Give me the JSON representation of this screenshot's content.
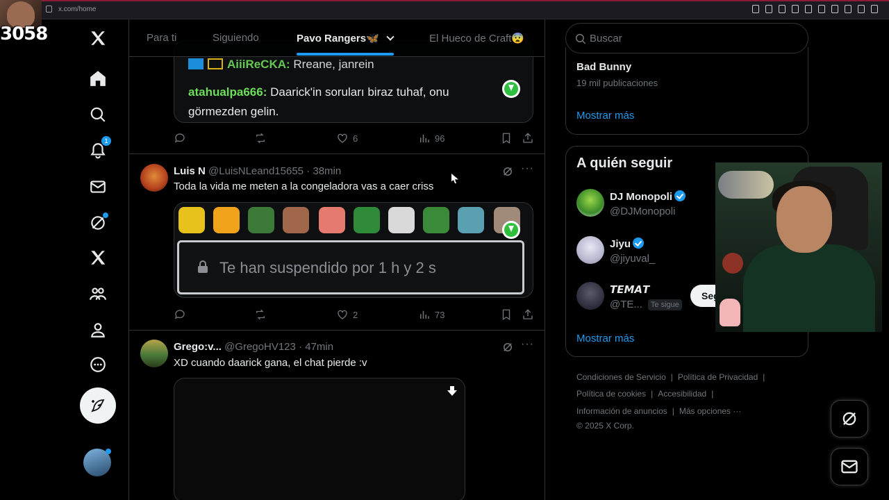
{
  "browser": {
    "url": "x.com/home"
  },
  "overlay": {
    "counter": "3058"
  },
  "nav": {
    "notifications_badge": "1"
  },
  "tabs": [
    {
      "label": "Para ti"
    },
    {
      "label": "Siguiendo"
    },
    {
      "label": "Pavo Rangers🦋"
    },
    {
      "label": "El Hueco de Craft😨"
    }
  ],
  "tweets": [
    {
      "chat_lines": [
        {
          "user": "AiiiReCKA:",
          "text": " Rreane, janrein"
        },
        {
          "user": "atahualpa666:",
          "text": " Daarick'in soruları biraz tuhaf, onu"
        },
        {
          "user": "",
          "text": "görmezden gelin."
        }
      ],
      "likes": "6",
      "views": "96"
    },
    {
      "name": "Luis N",
      "handle": "@LuisNLeand15655",
      "time": "· 38min",
      "text": "Toda la vida me meten a la congeladora vas a caer criss",
      "suspended_text": "Te han suspendido por 1 h y 2 s",
      "likes": "2",
      "views": "73"
    },
    {
      "name": "Grego:v...",
      "handle": "@GregoHV123",
      "time": "· 47min",
      "text": "XD cuando daarick gana, el chat pierde :v"
    }
  ],
  "sidebar": {
    "search_placeholder": "Buscar",
    "trend_name": "Bad Bunny",
    "trend_count": "19 mil publicaciones",
    "show_more_1": "Mostrar más",
    "who_to_follow_title": "A quién seguir",
    "suggestions": [
      {
        "name": "DJ Monopoli",
        "handle": "@DJMonopoli"
      },
      {
        "name": "Jiyu",
        "handle": "@jiyuval_"
      },
      {
        "name": "𝙏𝙀𝙈𝘼𝙏",
        "handle": "@TE...",
        "follows_you": "Te sigue"
      }
    ],
    "follow_label": "Seguir",
    "show_more_2": "Mostrar más",
    "footer": {
      "terms": "Condiciones de Servicio",
      "privacy": "Política de Privacidad",
      "cookies": "Política de cookies",
      "accessibility": "Accesibilidad",
      "ads": "Información de anuncios",
      "more": "Más opciones ···",
      "copyright": "© 2025 X Corp."
    }
  },
  "colors": {
    "accent": "#1d9bf0",
    "chat_user": "#6dde59",
    "background": "#000000"
  }
}
